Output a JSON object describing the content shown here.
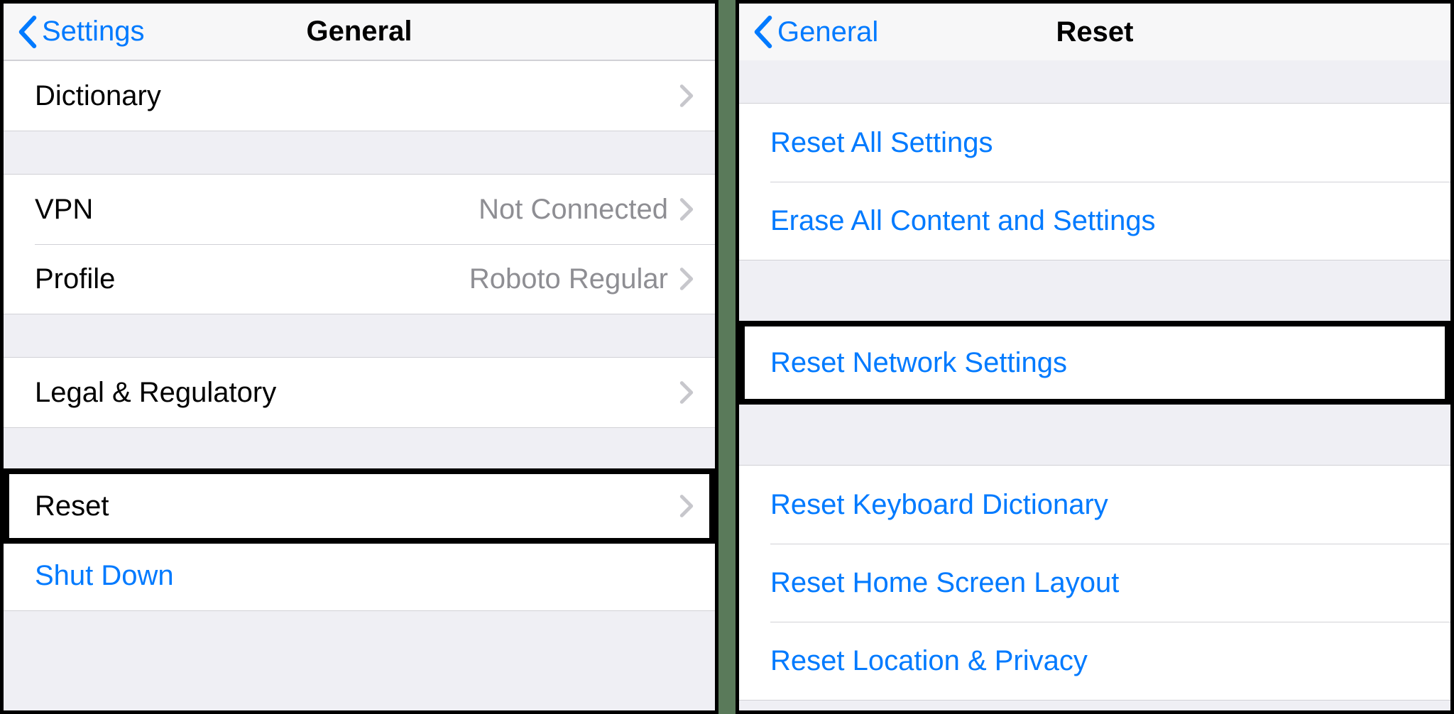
{
  "left": {
    "back_label": "Settings",
    "title": "General",
    "rows": {
      "dictionary": "Dictionary",
      "vpn": "VPN",
      "vpn_status": "Not Connected",
      "profile": "Profile",
      "profile_value": "Roboto Regular",
      "legal": "Legal & Regulatory",
      "reset": "Reset",
      "shutdown": "Shut Down"
    }
  },
  "right": {
    "back_label": "General",
    "title": "Reset",
    "rows": {
      "reset_all": "Reset All Settings",
      "erase_all": "Erase All Content and Settings",
      "reset_network": "Reset Network Settings",
      "reset_keyboard": "Reset Keyboard Dictionary",
      "reset_home": "Reset Home Screen Layout",
      "reset_location": "Reset Location & Privacy"
    }
  }
}
